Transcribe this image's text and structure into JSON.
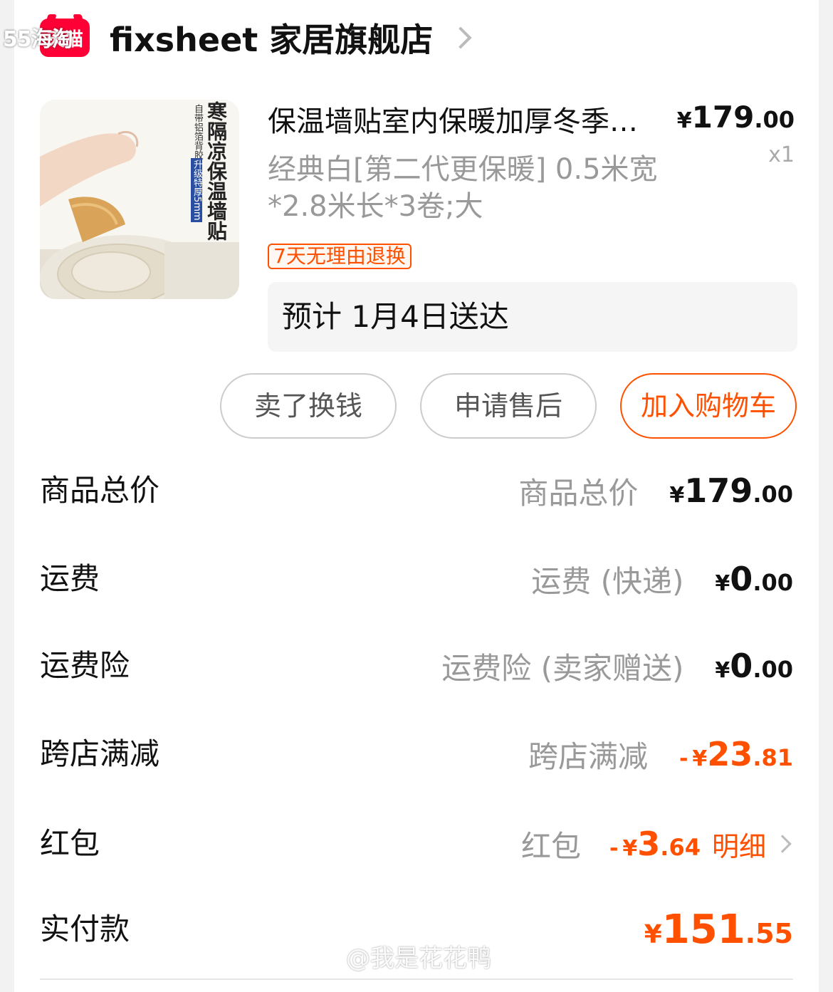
{
  "watermark_top": "55海淘",
  "shop": {
    "logo_text": "天猫",
    "name": "fixsheet 家居旗舰店"
  },
  "product": {
    "image_text": "寒隔凉保温墙贴",
    "image_subtext": "自带铝箔背胶",
    "image_badge": "升级特厚5mm",
    "title": "保温墙贴室内保暖加厚冬季防寒隔凉墙纸",
    "price_symbol": "¥",
    "price_int": "179",
    "price_dec": ".00",
    "quantity": "x1",
    "spec": "经典白[第二代更保暖] 0.5米宽*2.8米长*3卷;大",
    "return_tag": "7天无理由退换",
    "delivery": "预计 1月4日送达"
  },
  "actions": {
    "sell": "卖了换钱",
    "after_sale": "申请售后",
    "add_cart": "加入购物车"
  },
  "fees": {
    "goods_total": {
      "label": "商品总价",
      "desc": "商品总价",
      "sym": "¥",
      "int": "179",
      "dec": ".00"
    },
    "shipping": {
      "label": "运费",
      "desc": "运费 (快递)",
      "sym": "¥",
      "int": "0",
      "dec": ".00"
    },
    "shipping_insurance": {
      "label": "运费险",
      "desc": "运费险 (卖家赠送)",
      "sym": "¥",
      "int": "0",
      "dec": ".00"
    },
    "cross_store": {
      "label": "跨店满减",
      "desc": "跨店满减",
      "minus": "-",
      "sym": "¥",
      "int": "23",
      "dec": ".81"
    },
    "red_packet": {
      "label": "红包",
      "desc": "红包",
      "minus": "-",
      "sym": "¥",
      "int": "3",
      "dec": ".64",
      "detail": "明细"
    },
    "paid": {
      "label": "实付款",
      "sym": "¥",
      "int": "151",
      "dec": ".55"
    }
  },
  "watermark_bottom": "@我是花花鸭",
  "colors": {
    "accent": "#ff5000",
    "tmall": "#ff0036",
    "muted": "#999999"
  }
}
